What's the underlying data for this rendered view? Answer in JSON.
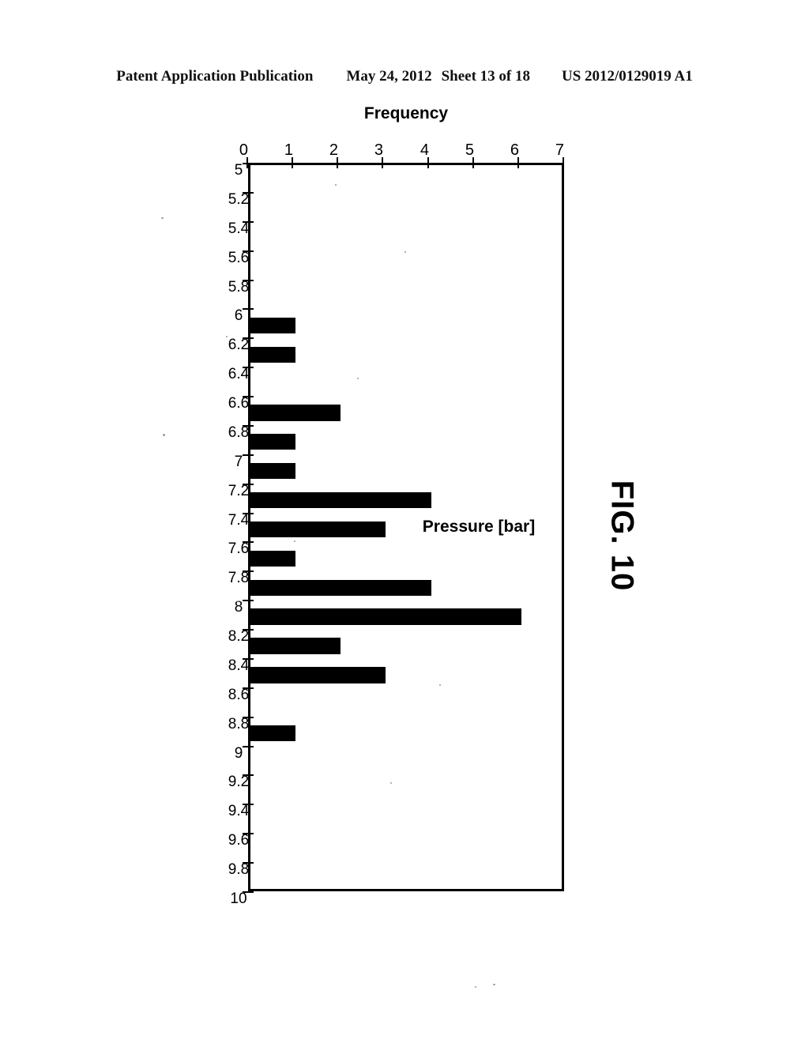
{
  "header": {
    "publication": "Patent Application Publication",
    "date": "May 24, 2012",
    "sheet": "Sheet 13 of 18",
    "docnumber": "US 2012/0129019 A1"
  },
  "figure": {
    "caption": "FIG. 10"
  },
  "chart_data": {
    "type": "bar",
    "title": "",
    "xlabel": "Pressure [bar]",
    "ylabel": "Frequency",
    "orientation": "rotated-90-clockwise",
    "grid": false,
    "legend": null,
    "xlim": [
      5,
      10
    ],
    "ylim": [
      0,
      7
    ],
    "xtick_step": 0.2,
    "ytick_step": 1,
    "categories": [
      "5",
      "5.2",
      "5.4",
      "5.6",
      "5.8",
      "6",
      "6.2",
      "6.4",
      "6.6",
      "6.8",
      "7",
      "7.2",
      "7.4",
      "7.6",
      "7.8",
      "8",
      "8.2",
      "8.4",
      "8.6",
      "8.8",
      "9",
      "9.2",
      "9.4",
      "9.6",
      "9.8",
      "10"
    ],
    "ytick_labels": [
      "7",
      "6",
      "5",
      "4",
      "3",
      "2",
      "1",
      "0"
    ],
    "values": [
      0,
      0,
      0,
      0,
      0,
      0,
      1,
      1,
      0,
      2,
      1,
      1,
      4,
      3,
      1,
      4,
      6,
      2,
      3,
      0,
      1,
      0,
      0,
      0,
      0,
      0
    ],
    "bar_color": "#000000",
    "bars": [
      {
        "bin": "6.2",
        "frequency": 1
      },
      {
        "bin": "6.4",
        "frequency": 1
      },
      {
        "bin": "6.8",
        "frequency": 2
      },
      {
        "bin": "7",
        "frequency": 1
      },
      {
        "bin": "7.2",
        "frequency": 1
      },
      {
        "bin": "7.4",
        "frequency": 4
      },
      {
        "bin": "7.6",
        "frequency": 3
      },
      {
        "bin": "7.8",
        "frequency": 1
      },
      {
        "bin": "8",
        "frequency": 4
      },
      {
        "bin": "8.2",
        "frequency": 6
      },
      {
        "bin": "8.4",
        "frequency": 2
      },
      {
        "bin": "8.6",
        "frequency": 3
      },
      {
        "bin": "9",
        "frequency": 1
      }
    ]
  }
}
